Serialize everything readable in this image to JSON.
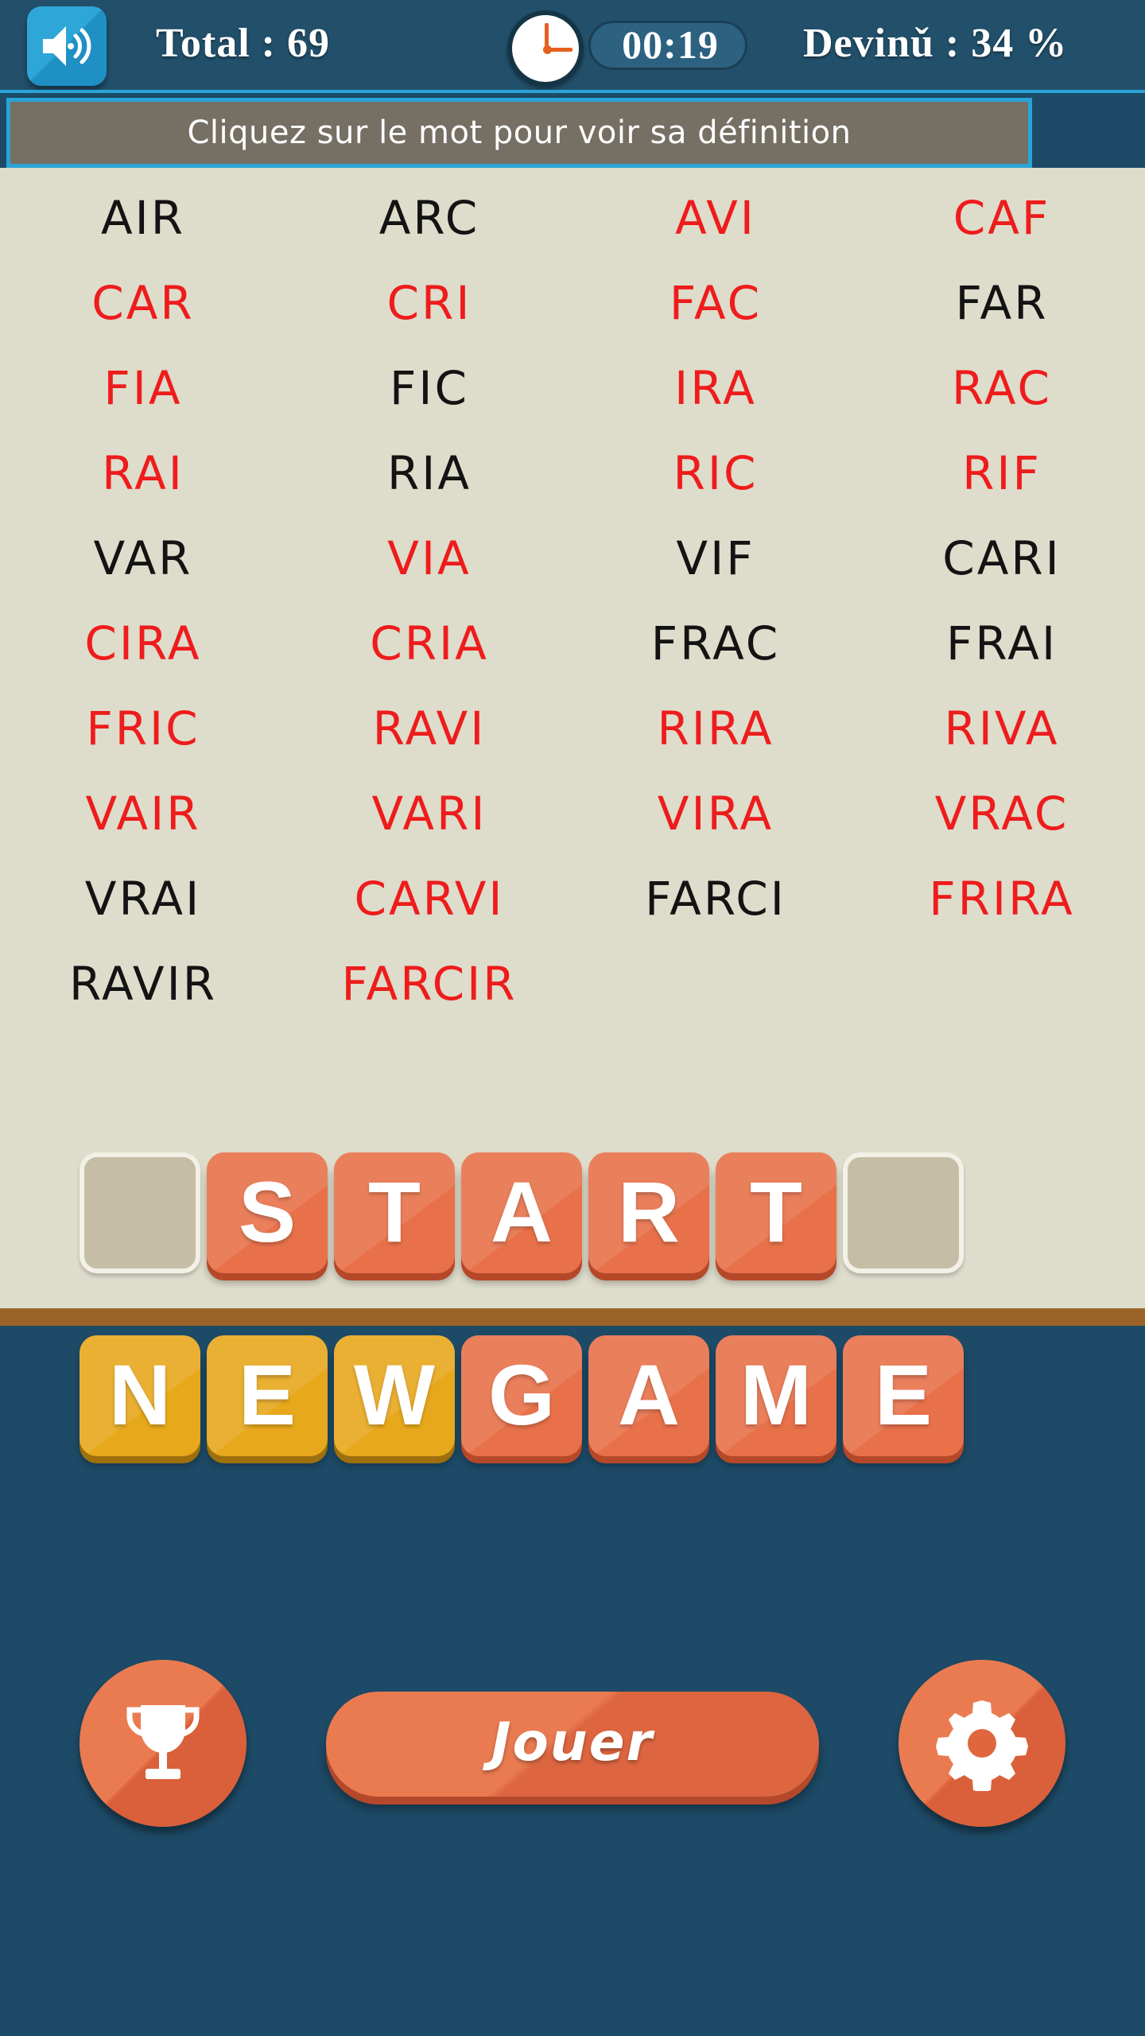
{
  "header": {
    "sound_icon": "speaker-on-icon",
    "total_label": "Total : 69",
    "clock_icon": "clock-icon",
    "timer": "00:19",
    "guess_label": "Devinǔ : 34 %"
  },
  "banner": {
    "text": "Cliquez sur le mot pour voir sa définition"
  },
  "board": {
    "rows": [
      [
        {
          "text": "AIR",
          "state": "black"
        },
        {
          "text": "ARC",
          "state": "black"
        },
        {
          "text": "AVI",
          "state": "red"
        },
        {
          "text": "CAF",
          "state": "red"
        }
      ],
      [
        {
          "text": "CAR",
          "state": "red"
        },
        {
          "text": "CRI",
          "state": "red"
        },
        {
          "text": "FAC",
          "state": "red"
        },
        {
          "text": "FAR",
          "state": "black"
        }
      ],
      [
        {
          "text": "FIA",
          "state": "red"
        },
        {
          "text": "FIC",
          "state": "black"
        },
        {
          "text": "IRA",
          "state": "red"
        },
        {
          "text": "RAC",
          "state": "red"
        }
      ],
      [
        {
          "text": "RAI",
          "state": "red"
        },
        {
          "text": "RIA",
          "state": "black"
        },
        {
          "text": "RIC",
          "state": "red"
        },
        {
          "text": "RIF",
          "state": "red"
        }
      ],
      [
        {
          "text": "VAR",
          "state": "black"
        },
        {
          "text": "VIA",
          "state": "red"
        },
        {
          "text": "VIF",
          "state": "black"
        },
        {
          "text": "CARI",
          "state": "black"
        }
      ],
      [
        {
          "text": "CIRA",
          "state": "red"
        },
        {
          "text": "CRIA",
          "state": "red"
        },
        {
          "text": "FRAC",
          "state": "black"
        },
        {
          "text": "FRAI",
          "state": "black"
        }
      ],
      [
        {
          "text": "FRIC",
          "state": "red"
        },
        {
          "text": "RAVI",
          "state": "red"
        },
        {
          "text": "RIRA",
          "state": "red"
        },
        {
          "text": "RIVA",
          "state": "red"
        }
      ],
      [
        {
          "text": "VAIR",
          "state": "red"
        },
        {
          "text": "VARI",
          "state": "red"
        },
        {
          "text": "VIRA",
          "state": "red"
        },
        {
          "text": "VRAC",
          "state": "red"
        }
      ],
      [
        {
          "text": "VRAI",
          "state": "black"
        },
        {
          "text": "CARVI",
          "state": "red"
        },
        {
          "text": "FARCI",
          "state": "black"
        },
        {
          "text": "FRIRA",
          "state": "red"
        }
      ],
      [
        {
          "text": "RAVIR",
          "state": "black"
        },
        {
          "text": "FARCIR",
          "state": "red"
        },
        {
          "text": "",
          "state": "empty"
        },
        {
          "text": "",
          "state": "empty"
        }
      ]
    ]
  },
  "letter_rack": {
    "tiles": [
      {
        "letter": "",
        "kind": "empty"
      },
      {
        "letter": "S",
        "kind": "orange"
      },
      {
        "letter": "T",
        "kind": "orange"
      },
      {
        "letter": "A",
        "kind": "orange"
      },
      {
        "letter": "R",
        "kind": "orange"
      },
      {
        "letter": "T",
        "kind": "orange"
      },
      {
        "letter": "",
        "kind": "empty"
      }
    ]
  },
  "newgame_rack": {
    "tiles": [
      {
        "letter": "N",
        "kind": "gold"
      },
      {
        "letter": "E",
        "kind": "gold"
      },
      {
        "letter": "W",
        "kind": "gold"
      },
      {
        "letter": "G",
        "kind": "orange"
      },
      {
        "letter": "A",
        "kind": "orange"
      },
      {
        "letter": "M",
        "kind": "orange"
      },
      {
        "letter": "E",
        "kind": "orange"
      }
    ]
  },
  "footer": {
    "trophy_icon": "trophy-icon",
    "play_label": "Jouer",
    "gear_icon": "gear-icon"
  },
  "colors": {
    "header_bg": "#22506b",
    "header_accent": "#2aa4d6",
    "board_bg": "#dedccb",
    "banner_bg": "#756f64",
    "panel_bg": "#1d4a66",
    "divider": "#9a6428",
    "word_found": "#ee1c1c",
    "word_pending": "#131313",
    "tile_orange": "#e8714a",
    "tile_gold": "#e8a81c",
    "tile_empty": "#c5bda6"
  }
}
